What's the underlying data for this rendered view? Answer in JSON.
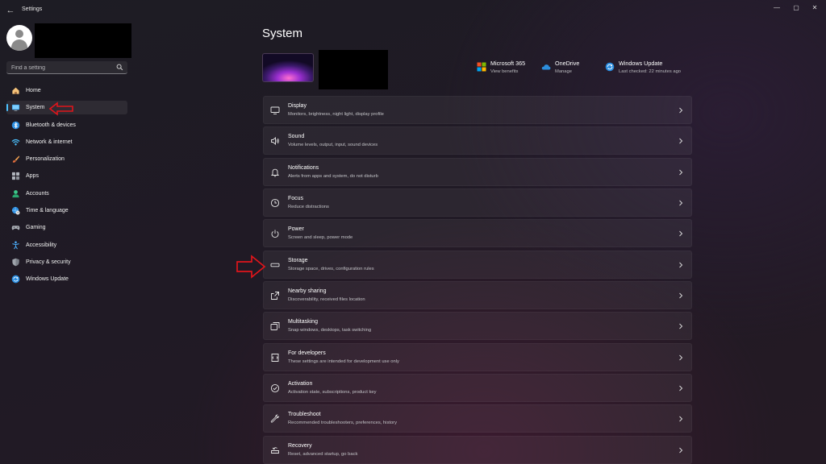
{
  "window": {
    "title": "Settings",
    "back_glyph": "←",
    "minimize_glyph": "—",
    "maximize_glyph": "▢",
    "close_glyph": "✕"
  },
  "sidebar": {
    "search": {
      "placeholder": "Find a setting",
      "value": ""
    },
    "items": [
      {
        "label": "Home",
        "icon": "home-icon"
      },
      {
        "label": "System",
        "icon": "system-icon",
        "selected": true
      },
      {
        "label": "Bluetooth & devices",
        "icon": "bluetooth-icon"
      },
      {
        "label": "Network & internet",
        "icon": "wifi-icon"
      },
      {
        "label": "Personalization",
        "icon": "brush-icon"
      },
      {
        "label": "Apps",
        "icon": "apps-icon"
      },
      {
        "label": "Accounts",
        "icon": "person-icon"
      },
      {
        "label": "Time & language",
        "icon": "globe-clock-icon"
      },
      {
        "label": "Gaming",
        "icon": "gamepad-icon"
      },
      {
        "label": "Accessibility",
        "icon": "accessibility-icon"
      },
      {
        "label": "Privacy & security",
        "icon": "shield-icon"
      },
      {
        "label": "Windows Update",
        "icon": "windows-update-icon"
      }
    ]
  },
  "main": {
    "title": "System",
    "quick_links": [
      {
        "title": "Microsoft 365",
        "subtitle": "View benefits",
        "icon": "microsoft-365-icon"
      },
      {
        "title": "OneDrive",
        "subtitle": "Manage",
        "icon": "onedrive-icon"
      },
      {
        "title": "Windows Update",
        "subtitle": "Last checked: 22 minutes ago",
        "icon": "windows-update-icon"
      }
    ],
    "settings": [
      {
        "title": "Display",
        "description": "Monitors, brightness, night light, display profile",
        "icon": "display-icon"
      },
      {
        "title": "Sound",
        "description": "Volume levels, output, input, sound devices",
        "icon": "speaker-icon"
      },
      {
        "title": "Notifications",
        "description": "Alerts from apps and system, do not disturb",
        "icon": "bell-icon"
      },
      {
        "title": "Focus",
        "description": "Reduce distractions",
        "icon": "focus-icon"
      },
      {
        "title": "Power",
        "description": "Screen and sleep, power mode",
        "icon": "power-icon"
      },
      {
        "title": "Storage",
        "description": "Storage space, drives, configuration rules",
        "icon": "storage-icon"
      },
      {
        "title": "Nearby sharing",
        "description": "Discoverability, received files location",
        "icon": "share-icon"
      },
      {
        "title": "Multitasking",
        "description": "Snap windows, desktops, task switching",
        "icon": "multitasking-icon"
      },
      {
        "title": "For developers",
        "description": "These settings are intended for development use only",
        "icon": "developer-icon"
      },
      {
        "title": "Activation",
        "description": "Activation state, subscriptions, product key",
        "icon": "check-circle-icon"
      },
      {
        "title": "Troubleshoot",
        "description": "Recommended troubleshooters, preferences, history",
        "icon": "wrench-icon"
      },
      {
        "title": "Recovery",
        "description": "Reset, advanced startup, go back",
        "icon": "recovery-icon"
      }
    ]
  },
  "colors": {
    "accent": "#4cc2ff",
    "annotation_arrow": "#e0151b"
  }
}
